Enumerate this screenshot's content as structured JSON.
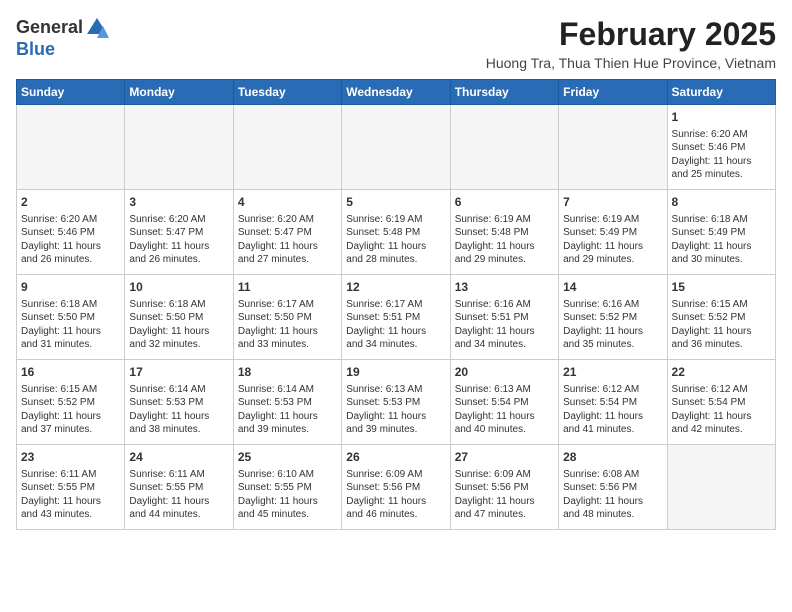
{
  "header": {
    "logo_line1": "General",
    "logo_line2": "Blue",
    "month_year": "February 2025",
    "location": "Huong Tra, Thua Thien Hue Province, Vietnam"
  },
  "weekdays": [
    "Sunday",
    "Monday",
    "Tuesday",
    "Wednesday",
    "Thursday",
    "Friday",
    "Saturday"
  ],
  "weeks": [
    [
      {
        "day": "",
        "info": ""
      },
      {
        "day": "",
        "info": ""
      },
      {
        "day": "",
        "info": ""
      },
      {
        "day": "",
        "info": ""
      },
      {
        "day": "",
        "info": ""
      },
      {
        "day": "",
        "info": ""
      },
      {
        "day": "1",
        "info": "Sunrise: 6:20 AM\nSunset: 5:46 PM\nDaylight: 11 hours\nand 25 minutes."
      }
    ],
    [
      {
        "day": "2",
        "info": "Sunrise: 6:20 AM\nSunset: 5:46 PM\nDaylight: 11 hours\nand 26 minutes."
      },
      {
        "day": "3",
        "info": "Sunrise: 6:20 AM\nSunset: 5:47 PM\nDaylight: 11 hours\nand 26 minutes."
      },
      {
        "day": "4",
        "info": "Sunrise: 6:20 AM\nSunset: 5:47 PM\nDaylight: 11 hours\nand 27 minutes."
      },
      {
        "day": "5",
        "info": "Sunrise: 6:19 AM\nSunset: 5:48 PM\nDaylight: 11 hours\nand 28 minutes."
      },
      {
        "day": "6",
        "info": "Sunrise: 6:19 AM\nSunset: 5:48 PM\nDaylight: 11 hours\nand 29 minutes."
      },
      {
        "day": "7",
        "info": "Sunrise: 6:19 AM\nSunset: 5:49 PM\nDaylight: 11 hours\nand 29 minutes."
      },
      {
        "day": "8",
        "info": "Sunrise: 6:18 AM\nSunset: 5:49 PM\nDaylight: 11 hours\nand 30 minutes."
      }
    ],
    [
      {
        "day": "9",
        "info": "Sunrise: 6:18 AM\nSunset: 5:50 PM\nDaylight: 11 hours\nand 31 minutes."
      },
      {
        "day": "10",
        "info": "Sunrise: 6:18 AM\nSunset: 5:50 PM\nDaylight: 11 hours\nand 32 minutes."
      },
      {
        "day": "11",
        "info": "Sunrise: 6:17 AM\nSunset: 5:50 PM\nDaylight: 11 hours\nand 33 minutes."
      },
      {
        "day": "12",
        "info": "Sunrise: 6:17 AM\nSunset: 5:51 PM\nDaylight: 11 hours\nand 34 minutes."
      },
      {
        "day": "13",
        "info": "Sunrise: 6:16 AM\nSunset: 5:51 PM\nDaylight: 11 hours\nand 34 minutes."
      },
      {
        "day": "14",
        "info": "Sunrise: 6:16 AM\nSunset: 5:52 PM\nDaylight: 11 hours\nand 35 minutes."
      },
      {
        "day": "15",
        "info": "Sunrise: 6:15 AM\nSunset: 5:52 PM\nDaylight: 11 hours\nand 36 minutes."
      }
    ],
    [
      {
        "day": "16",
        "info": "Sunrise: 6:15 AM\nSunset: 5:52 PM\nDaylight: 11 hours\nand 37 minutes."
      },
      {
        "day": "17",
        "info": "Sunrise: 6:14 AM\nSunset: 5:53 PM\nDaylight: 11 hours\nand 38 minutes."
      },
      {
        "day": "18",
        "info": "Sunrise: 6:14 AM\nSunset: 5:53 PM\nDaylight: 11 hours\nand 39 minutes."
      },
      {
        "day": "19",
        "info": "Sunrise: 6:13 AM\nSunset: 5:53 PM\nDaylight: 11 hours\nand 39 minutes."
      },
      {
        "day": "20",
        "info": "Sunrise: 6:13 AM\nSunset: 5:54 PM\nDaylight: 11 hours\nand 40 minutes."
      },
      {
        "day": "21",
        "info": "Sunrise: 6:12 AM\nSunset: 5:54 PM\nDaylight: 11 hours\nand 41 minutes."
      },
      {
        "day": "22",
        "info": "Sunrise: 6:12 AM\nSunset: 5:54 PM\nDaylight: 11 hours\nand 42 minutes."
      }
    ],
    [
      {
        "day": "23",
        "info": "Sunrise: 6:11 AM\nSunset: 5:55 PM\nDaylight: 11 hours\nand 43 minutes."
      },
      {
        "day": "24",
        "info": "Sunrise: 6:11 AM\nSunset: 5:55 PM\nDaylight: 11 hours\nand 44 minutes."
      },
      {
        "day": "25",
        "info": "Sunrise: 6:10 AM\nSunset: 5:55 PM\nDaylight: 11 hours\nand 45 minutes."
      },
      {
        "day": "26",
        "info": "Sunrise: 6:09 AM\nSunset: 5:56 PM\nDaylight: 11 hours\nand 46 minutes."
      },
      {
        "day": "27",
        "info": "Sunrise: 6:09 AM\nSunset: 5:56 PM\nDaylight: 11 hours\nand 47 minutes."
      },
      {
        "day": "28",
        "info": "Sunrise: 6:08 AM\nSunset: 5:56 PM\nDaylight: 11 hours\nand 48 minutes."
      },
      {
        "day": "",
        "info": ""
      }
    ]
  ]
}
